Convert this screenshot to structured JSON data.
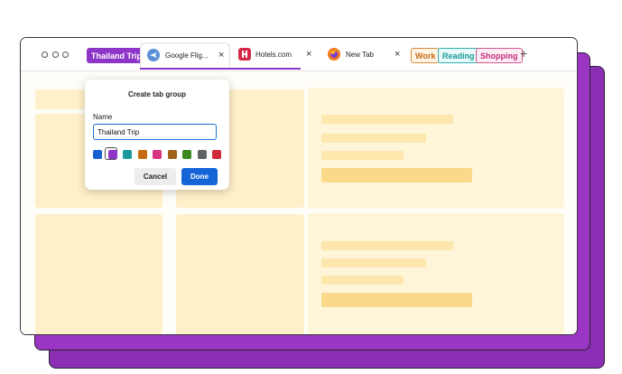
{
  "tabbar": {
    "groups": [
      {
        "label": "Thailand Trip",
        "bg": "#8e35c9",
        "fg": "#ffffff",
        "border": "#8e35c9"
      },
      {
        "label": "Work",
        "bg": "#fff4e6",
        "fg": "#c56a12",
        "border": "#d88a3c"
      },
      {
        "label": "Reading",
        "bg": "#e9fbfb",
        "fg": "#1a9a9a",
        "border": "#33b1b1"
      },
      {
        "label": "Shopping",
        "bg": "#fdeef5",
        "fg": "#c22f7a",
        "border": "#d8568f"
      }
    ],
    "tabs": [
      {
        "title": "Google Flig...",
        "icon": "airplane-icon"
      },
      {
        "title": "Hotels.com",
        "icon": "hotels-icon"
      },
      {
        "title": "New Tab",
        "icon": "firefox-icon"
      }
    ],
    "close_glyph": "×",
    "new_tab_glyph": "+"
  },
  "popup": {
    "title": "Create tab group",
    "name_label": "Name",
    "name_value": "Thailand Trip",
    "colors": [
      "#1a5fd0",
      "#8e35c9",
      "#1a9a9a",
      "#c56a12",
      "#d63383",
      "#a0621a",
      "#3a8a1f",
      "#5f6368",
      "#d12a3a"
    ],
    "selected_color_index": 1,
    "cancel_label": "Cancel",
    "done_label": "Done"
  },
  "colors": {
    "accent": "#8e35c9",
    "window_shadow": "#9b35c4",
    "placeholder_light": "#fff0c9",
    "placeholder_bar": "#fde7ad"
  }
}
